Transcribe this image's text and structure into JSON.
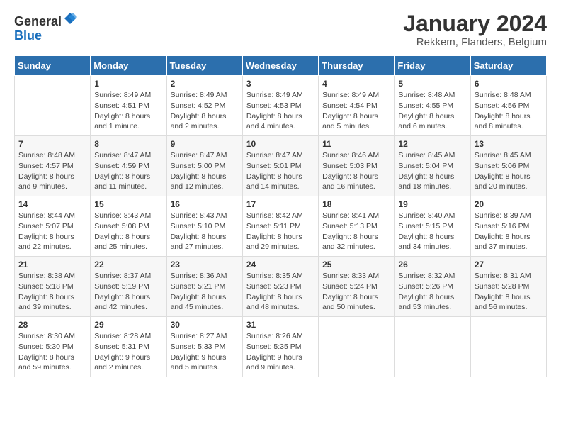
{
  "logo": {
    "general": "General",
    "blue": "Blue"
  },
  "header": {
    "month_year": "January 2024",
    "location": "Rekkem, Flanders, Belgium"
  },
  "days_of_week": [
    "Sunday",
    "Monday",
    "Tuesday",
    "Wednesday",
    "Thursday",
    "Friday",
    "Saturday"
  ],
  "weeks": [
    [
      {
        "day": "",
        "info": ""
      },
      {
        "day": "1",
        "info": "Sunrise: 8:49 AM\nSunset: 4:51 PM\nDaylight: 8 hours\nand 1 minute."
      },
      {
        "day": "2",
        "info": "Sunrise: 8:49 AM\nSunset: 4:52 PM\nDaylight: 8 hours\nand 2 minutes."
      },
      {
        "day": "3",
        "info": "Sunrise: 8:49 AM\nSunset: 4:53 PM\nDaylight: 8 hours\nand 4 minutes."
      },
      {
        "day": "4",
        "info": "Sunrise: 8:49 AM\nSunset: 4:54 PM\nDaylight: 8 hours\nand 5 minutes."
      },
      {
        "day": "5",
        "info": "Sunrise: 8:48 AM\nSunset: 4:55 PM\nDaylight: 8 hours\nand 6 minutes."
      },
      {
        "day": "6",
        "info": "Sunrise: 8:48 AM\nSunset: 4:56 PM\nDaylight: 8 hours\nand 8 minutes."
      }
    ],
    [
      {
        "day": "7",
        "info": "Sunrise: 8:48 AM\nSunset: 4:57 PM\nDaylight: 8 hours\nand 9 minutes."
      },
      {
        "day": "8",
        "info": "Sunrise: 8:47 AM\nSunset: 4:59 PM\nDaylight: 8 hours\nand 11 minutes."
      },
      {
        "day": "9",
        "info": "Sunrise: 8:47 AM\nSunset: 5:00 PM\nDaylight: 8 hours\nand 12 minutes."
      },
      {
        "day": "10",
        "info": "Sunrise: 8:47 AM\nSunset: 5:01 PM\nDaylight: 8 hours\nand 14 minutes."
      },
      {
        "day": "11",
        "info": "Sunrise: 8:46 AM\nSunset: 5:03 PM\nDaylight: 8 hours\nand 16 minutes."
      },
      {
        "day": "12",
        "info": "Sunrise: 8:45 AM\nSunset: 5:04 PM\nDaylight: 8 hours\nand 18 minutes."
      },
      {
        "day": "13",
        "info": "Sunrise: 8:45 AM\nSunset: 5:06 PM\nDaylight: 8 hours\nand 20 minutes."
      }
    ],
    [
      {
        "day": "14",
        "info": "Sunrise: 8:44 AM\nSunset: 5:07 PM\nDaylight: 8 hours\nand 22 minutes."
      },
      {
        "day": "15",
        "info": "Sunrise: 8:43 AM\nSunset: 5:08 PM\nDaylight: 8 hours\nand 25 minutes."
      },
      {
        "day": "16",
        "info": "Sunrise: 8:43 AM\nSunset: 5:10 PM\nDaylight: 8 hours\nand 27 minutes."
      },
      {
        "day": "17",
        "info": "Sunrise: 8:42 AM\nSunset: 5:11 PM\nDaylight: 8 hours\nand 29 minutes."
      },
      {
        "day": "18",
        "info": "Sunrise: 8:41 AM\nSunset: 5:13 PM\nDaylight: 8 hours\nand 32 minutes."
      },
      {
        "day": "19",
        "info": "Sunrise: 8:40 AM\nSunset: 5:15 PM\nDaylight: 8 hours\nand 34 minutes."
      },
      {
        "day": "20",
        "info": "Sunrise: 8:39 AM\nSunset: 5:16 PM\nDaylight: 8 hours\nand 37 minutes."
      }
    ],
    [
      {
        "day": "21",
        "info": "Sunrise: 8:38 AM\nSunset: 5:18 PM\nDaylight: 8 hours\nand 39 minutes."
      },
      {
        "day": "22",
        "info": "Sunrise: 8:37 AM\nSunset: 5:19 PM\nDaylight: 8 hours\nand 42 minutes."
      },
      {
        "day": "23",
        "info": "Sunrise: 8:36 AM\nSunset: 5:21 PM\nDaylight: 8 hours\nand 45 minutes."
      },
      {
        "day": "24",
        "info": "Sunrise: 8:35 AM\nSunset: 5:23 PM\nDaylight: 8 hours\nand 48 minutes."
      },
      {
        "day": "25",
        "info": "Sunrise: 8:33 AM\nSunset: 5:24 PM\nDaylight: 8 hours\nand 50 minutes."
      },
      {
        "day": "26",
        "info": "Sunrise: 8:32 AM\nSunset: 5:26 PM\nDaylight: 8 hours\nand 53 minutes."
      },
      {
        "day": "27",
        "info": "Sunrise: 8:31 AM\nSunset: 5:28 PM\nDaylight: 8 hours\nand 56 minutes."
      }
    ],
    [
      {
        "day": "28",
        "info": "Sunrise: 8:30 AM\nSunset: 5:30 PM\nDaylight: 8 hours\nand 59 minutes."
      },
      {
        "day": "29",
        "info": "Sunrise: 8:28 AM\nSunset: 5:31 PM\nDaylight: 9 hours\nand 2 minutes."
      },
      {
        "day": "30",
        "info": "Sunrise: 8:27 AM\nSunset: 5:33 PM\nDaylight: 9 hours\nand 5 minutes."
      },
      {
        "day": "31",
        "info": "Sunrise: 8:26 AM\nSunset: 5:35 PM\nDaylight: 9 hours\nand 9 minutes."
      },
      {
        "day": "",
        "info": ""
      },
      {
        "day": "",
        "info": ""
      },
      {
        "day": "",
        "info": ""
      }
    ]
  ]
}
